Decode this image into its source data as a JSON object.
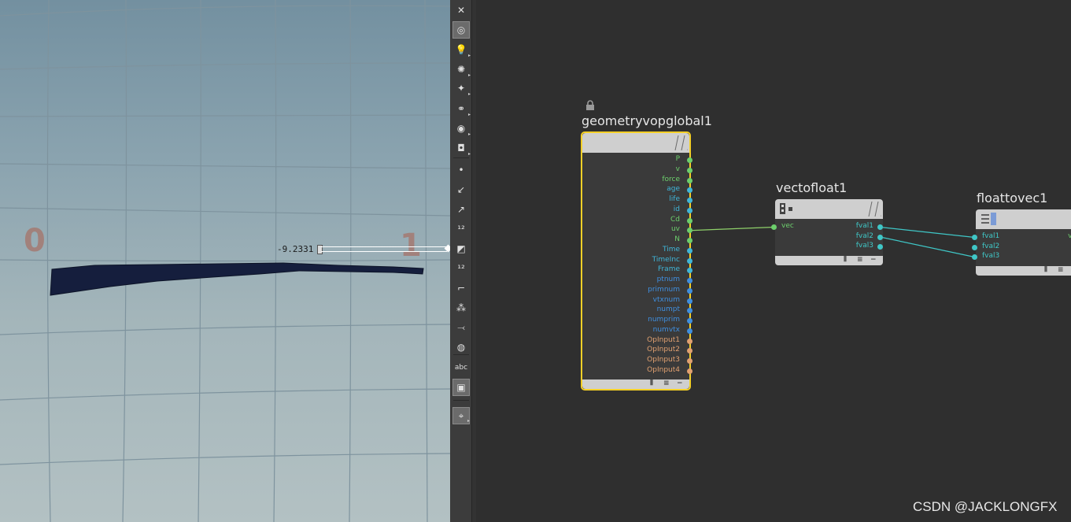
{
  "viewport": {
    "uv_label_left": "0",
    "uv_label_right": "1",
    "value_readout": "-9.2331"
  },
  "toolbar": {
    "tools": [
      {
        "name": "close-icon",
        "glyph": "✕"
      },
      {
        "name": "display-options-icon",
        "glyph": "◎"
      },
      {
        "name": "light-icon",
        "glyph": "💡"
      },
      {
        "name": "light-bulb-icon",
        "glyph": "✺"
      },
      {
        "name": "light-rig-icon",
        "glyph": "✦"
      },
      {
        "name": "vertex-group-icon",
        "glyph": "⚭"
      },
      {
        "name": "visibility-eye-icon",
        "glyph": "◉"
      },
      {
        "name": "camera-icon",
        "glyph": "◘"
      },
      {
        "name": "point-icon",
        "glyph": "•"
      },
      {
        "name": "vector-icon",
        "glyph": "↙"
      },
      {
        "name": "normal-icon",
        "glyph": "↗"
      },
      {
        "name": "point-number-icon",
        "glyph": "¹²"
      },
      {
        "name": "primitive-icon",
        "glyph": "◩"
      },
      {
        "name": "primitive-number-icon",
        "glyph": "¹²"
      },
      {
        "name": "edge-icon",
        "glyph": "⌐"
      },
      {
        "name": "grid-points-icon",
        "glyph": "⁂"
      },
      {
        "name": "branch-icon",
        "glyph": "⤙"
      },
      {
        "name": "circle-display-icon",
        "glyph": "◍"
      },
      {
        "name": "text-label-icon",
        "glyph": "abc"
      },
      {
        "name": "background-image-icon",
        "glyph": "▣"
      },
      {
        "name": "map-pin-icon",
        "glyph": "⌖"
      }
    ]
  },
  "network": {
    "nodes": {
      "global": {
        "title": "geometryvopglobal1",
        "outputs": [
          "P",
          "v",
          "force",
          "age",
          "life",
          "id",
          "Cd",
          "uv",
          "N",
          "Time",
          "TimeInc",
          "Frame",
          "ptnum",
          "primnum",
          "vtxnum",
          "numpt",
          "numprim",
          "numvtx",
          "OpInput1",
          "OpInput2",
          "OpInput3",
          "OpInput4"
        ],
        "output_colors": [
          "#6ccf6c",
          "#6ccf6c",
          "#6ccf6c",
          "#3fb6d9",
          "#3fb6d9",
          "#3fb6d9",
          "#6ccf6c",
          "#6ccf6c",
          "#6ccf6c",
          "#3fb6d9",
          "#3fb6d9",
          "#3fb6d9",
          "#3f8fe0",
          "#3f8fe0",
          "#3f8fe0",
          "#3f8fe0",
          "#3f8fe0",
          "#3f8fe0",
          "#e0a070",
          "#e0a070",
          "#e0a070",
          "#e0a070"
        ]
      },
      "vectofloat": {
        "title": "vectofloat1",
        "inputs": [
          "vec"
        ],
        "outputs": [
          "fval1",
          "fval2",
          "fval3"
        ]
      },
      "floattovec": {
        "title": "floattovec1",
        "inputs": [
          "fval1",
          "fval2",
          "fval3"
        ],
        "outputs": [
          "ve"
        ]
      }
    },
    "colors": {
      "selected_border": "#f4d027",
      "vector_wire": "#8fd16a",
      "float_wire": "#3fc7c7",
      "float_port": "#3fc7c7",
      "vector_port": "#6ccf6c"
    }
  },
  "watermark": "CSDN @JACKLONGFX"
}
